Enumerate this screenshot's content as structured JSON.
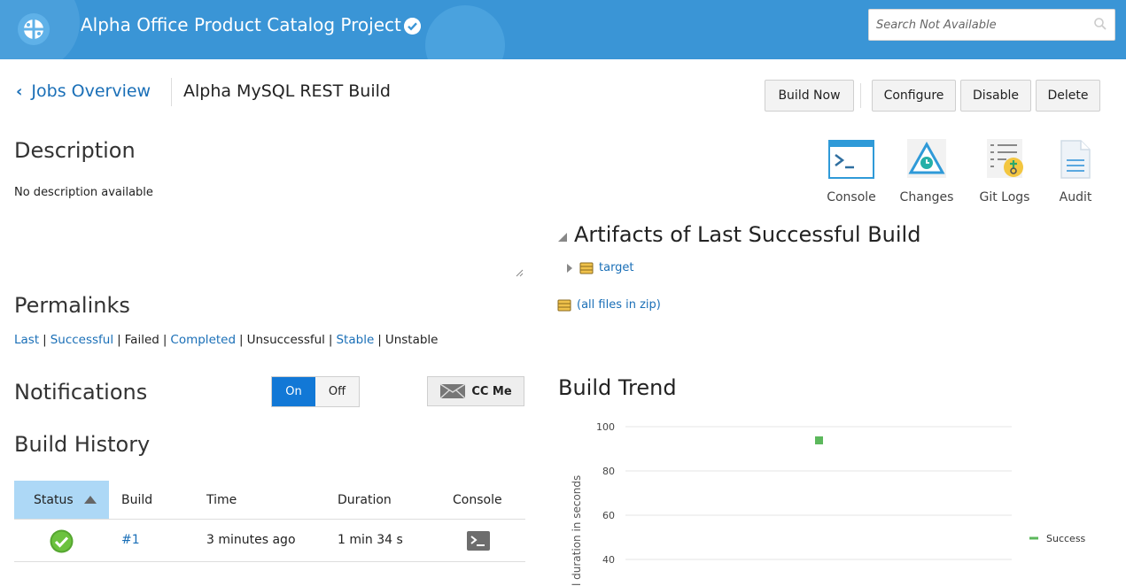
{
  "header": {
    "project_title": "Alpha Office Product Catalog Project",
    "search_placeholder": "Search Not Available",
    "colors": {
      "bar": "#3a95d6",
      "link": "#1a6fb7",
      "accent": "#1278d6"
    }
  },
  "breadcrumb": {
    "back_label": "Jobs Overview",
    "job_title": "Alpha MySQL REST Build"
  },
  "actions": {
    "build_now": "Build Now",
    "configure": "Configure",
    "disable": "Disable",
    "delete": "Delete"
  },
  "tools": [
    {
      "label": "Console",
      "icon": "console-icon"
    },
    {
      "label": "Changes",
      "icon": "changes-icon"
    },
    {
      "label": "Git Logs",
      "icon": "git-logs-icon"
    },
    {
      "label": "Audit",
      "icon": "audit-icon"
    }
  ],
  "description": {
    "title": "Description",
    "text": "No description available"
  },
  "permalinks": {
    "title": "Permalinks",
    "items": [
      {
        "label": "Last",
        "link": true
      },
      {
        "label": "Successful",
        "link": true
      },
      {
        "label": "Failed",
        "link": false
      },
      {
        "label": "Completed",
        "link": true
      },
      {
        "label": "Unsuccessful",
        "link": false
      },
      {
        "label": "Stable",
        "link": true
      },
      {
        "label": "Unstable",
        "link": false
      }
    ]
  },
  "notifications": {
    "title": "Notifications",
    "on_label": "On",
    "off_label": "Off",
    "selected": "On",
    "cc_me": "CC Me"
  },
  "build_history": {
    "title": "Build History",
    "columns": [
      "Status",
      "Build",
      "Time",
      "Duration",
      "Console"
    ],
    "rows": [
      {
        "status": "success",
        "build": "#1",
        "time": "3 minutes ago",
        "duration": "1 min 34 s"
      }
    ]
  },
  "artifacts": {
    "title": "Artifacts of Last Successful Build",
    "items": [
      {
        "label": "target"
      }
    ],
    "zip_label": "(all files in zip)"
  },
  "build_trend": {
    "title": "Build Trend"
  },
  "chart_data": {
    "type": "scatter",
    "ylabel": "l duration in seconds",
    "y_ticks": [
      40,
      60,
      80,
      100
    ],
    "ylim": [
      40,
      100
    ],
    "series": [
      {
        "name": "Success",
        "color": "#5cb85c",
        "values": [
          94
        ]
      }
    ],
    "legend": "right",
    "grid": true
  }
}
